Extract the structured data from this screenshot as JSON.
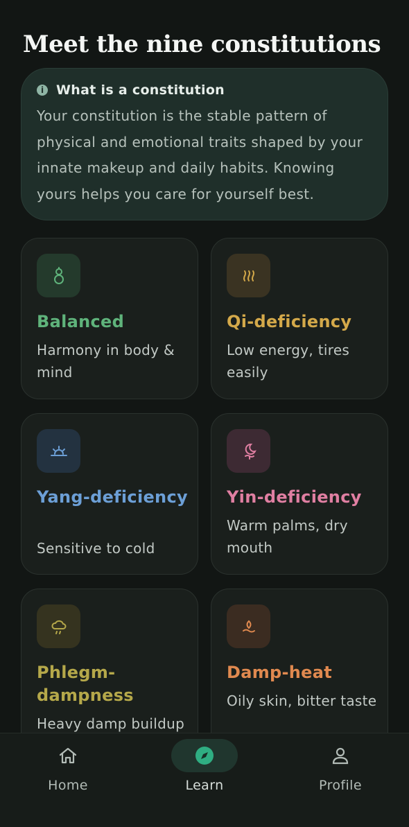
{
  "page": {
    "title": "Meet the nine constitutions"
  },
  "info": {
    "title": "What is a constitution",
    "body": "Your constitution is the stable pattern of physical and emotional traits shaped by your innate makeup and daily habits. Knowing yours helps you care for yourself best."
  },
  "cards": [
    {
      "name": "Balanced",
      "desc": "Harmony in body & mind",
      "color": "#5fb37b",
      "icon": "gourd-icon"
    },
    {
      "name": "Qi-deficiency",
      "desc": "Low energy, tires easily",
      "color": "#d4a94a",
      "icon": "heat-waves-icon"
    },
    {
      "name": "Yang-deficiency",
      "desc": "Sensitive to cold",
      "color": "#6c9fd6",
      "icon": "sunset-icon"
    },
    {
      "name": "Yin-deficiency",
      "desc": "Warm palms, dry mouth",
      "color": "#e07fa2",
      "icon": "moon-icon"
    },
    {
      "name": "Phlegm-dampness",
      "desc": "Heavy damp buildup",
      "color": "#b5a84a",
      "icon": "cloud-drizzle-icon"
    },
    {
      "name": "Damp-heat",
      "desc": "Oily skin, bitter taste",
      "color": "#e0894f",
      "icon": "flame-water-icon"
    }
  ],
  "nav": {
    "items": [
      {
        "label": "Home",
        "icon": "home-icon",
        "active": false
      },
      {
        "label": "Learn",
        "icon": "compass-icon",
        "active": true
      },
      {
        "label": "Profile",
        "icon": "person-icon",
        "active": false
      }
    ],
    "active_color": "#2fae82"
  }
}
